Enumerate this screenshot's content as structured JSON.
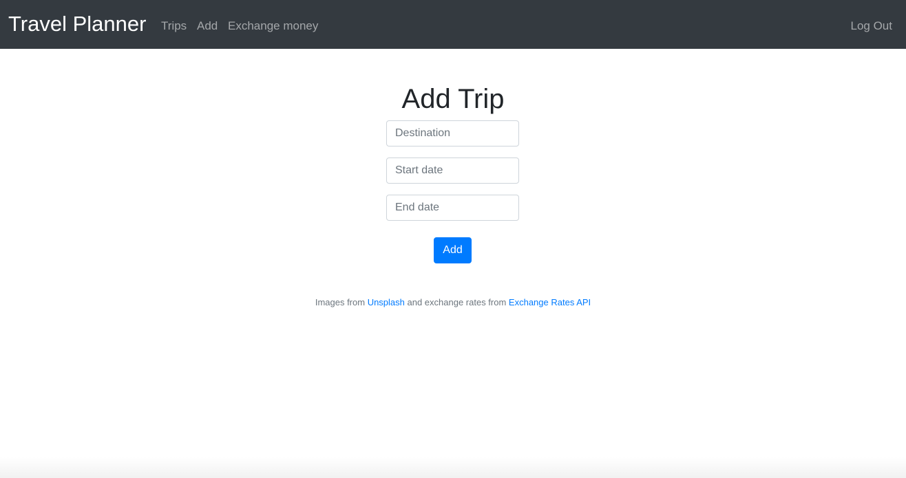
{
  "navbar": {
    "brand": "Travel Planner",
    "links": [
      {
        "label": "Trips"
      },
      {
        "label": "Add"
      },
      {
        "label": "Exchange money"
      }
    ],
    "logout_label": "Log Out",
    "background_color": "#343a40"
  },
  "main": {
    "title": "Add Trip",
    "fields": {
      "destination": {
        "value": "",
        "placeholder": "Destination"
      },
      "start_date": {
        "value": "",
        "placeholder": "Start date"
      },
      "end_date": {
        "value": "",
        "placeholder": "End date"
      }
    },
    "submit_label": "Add",
    "accent_color": "#007bff"
  },
  "footer": {
    "prefix": "Images from ",
    "unsplash_label": "Unsplash",
    "middle": " and exchange rates from ",
    "api_label": "Exchange Rates API"
  }
}
